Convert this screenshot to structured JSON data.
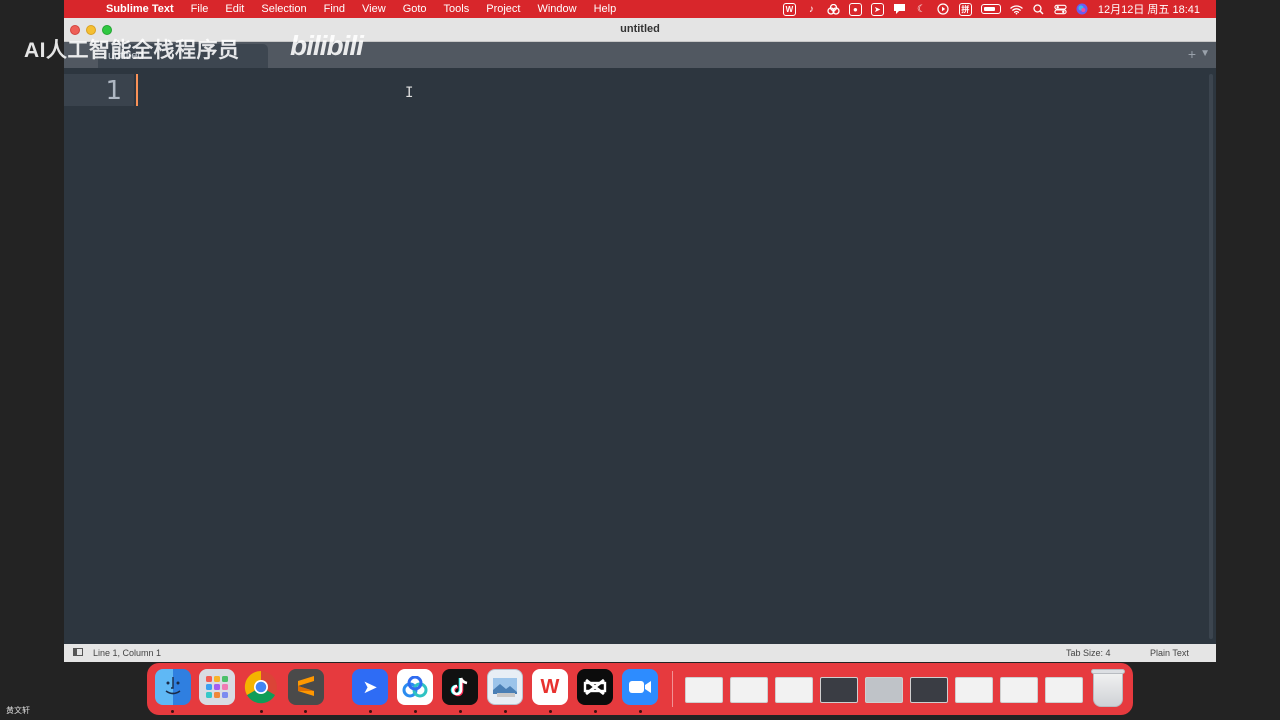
{
  "menubar": {
    "apple_icon": "apple-icon",
    "items": [
      "Sublime Text",
      "File",
      "Edit",
      "Selection",
      "Find",
      "View",
      "Goto",
      "Tools",
      "Project",
      "Window",
      "Help"
    ],
    "status_icons": [
      "wps-icon",
      "tiktok-icon",
      "baidu-netdisk-icon",
      "screen-record-icon",
      "feishu-icon",
      "message-icon",
      "moon-icon",
      "play-icon",
      "input-method-icon",
      "battery-icon",
      "wifi-icon",
      "search-icon",
      "control-center-icon",
      "siri-icon"
    ],
    "input_method_label": "拼",
    "clock": "12月12日 周五  18:41"
  },
  "window": {
    "title": "untitled",
    "tab_label": "untitled",
    "new_tab_glyph": "+",
    "tab_menu_glyph": "▼"
  },
  "editor": {
    "line_numbers": [
      "1"
    ],
    "content": "",
    "caret_color": "#f99157",
    "background": "#2d363f"
  },
  "statusbar": {
    "position": "Line 1, Column 1",
    "tab_size": "Tab Size: 4",
    "syntax": "Plain Text"
  },
  "watermark": {
    "text": "AI人工智能全栈程序员",
    "logo": "bilibili"
  },
  "dock": {
    "apps": [
      "finder-icon",
      "launchpad-icon",
      "chrome-icon",
      "sublime-text-icon",
      "feishu-icon",
      "baidu-netdisk-icon",
      "tiktok-icon",
      "preview-icon",
      "wps-icon",
      "capcut-icon",
      "zoom-icon"
    ],
    "trash_icon": "trash-icon"
  },
  "corner_label": "黄文轩"
}
